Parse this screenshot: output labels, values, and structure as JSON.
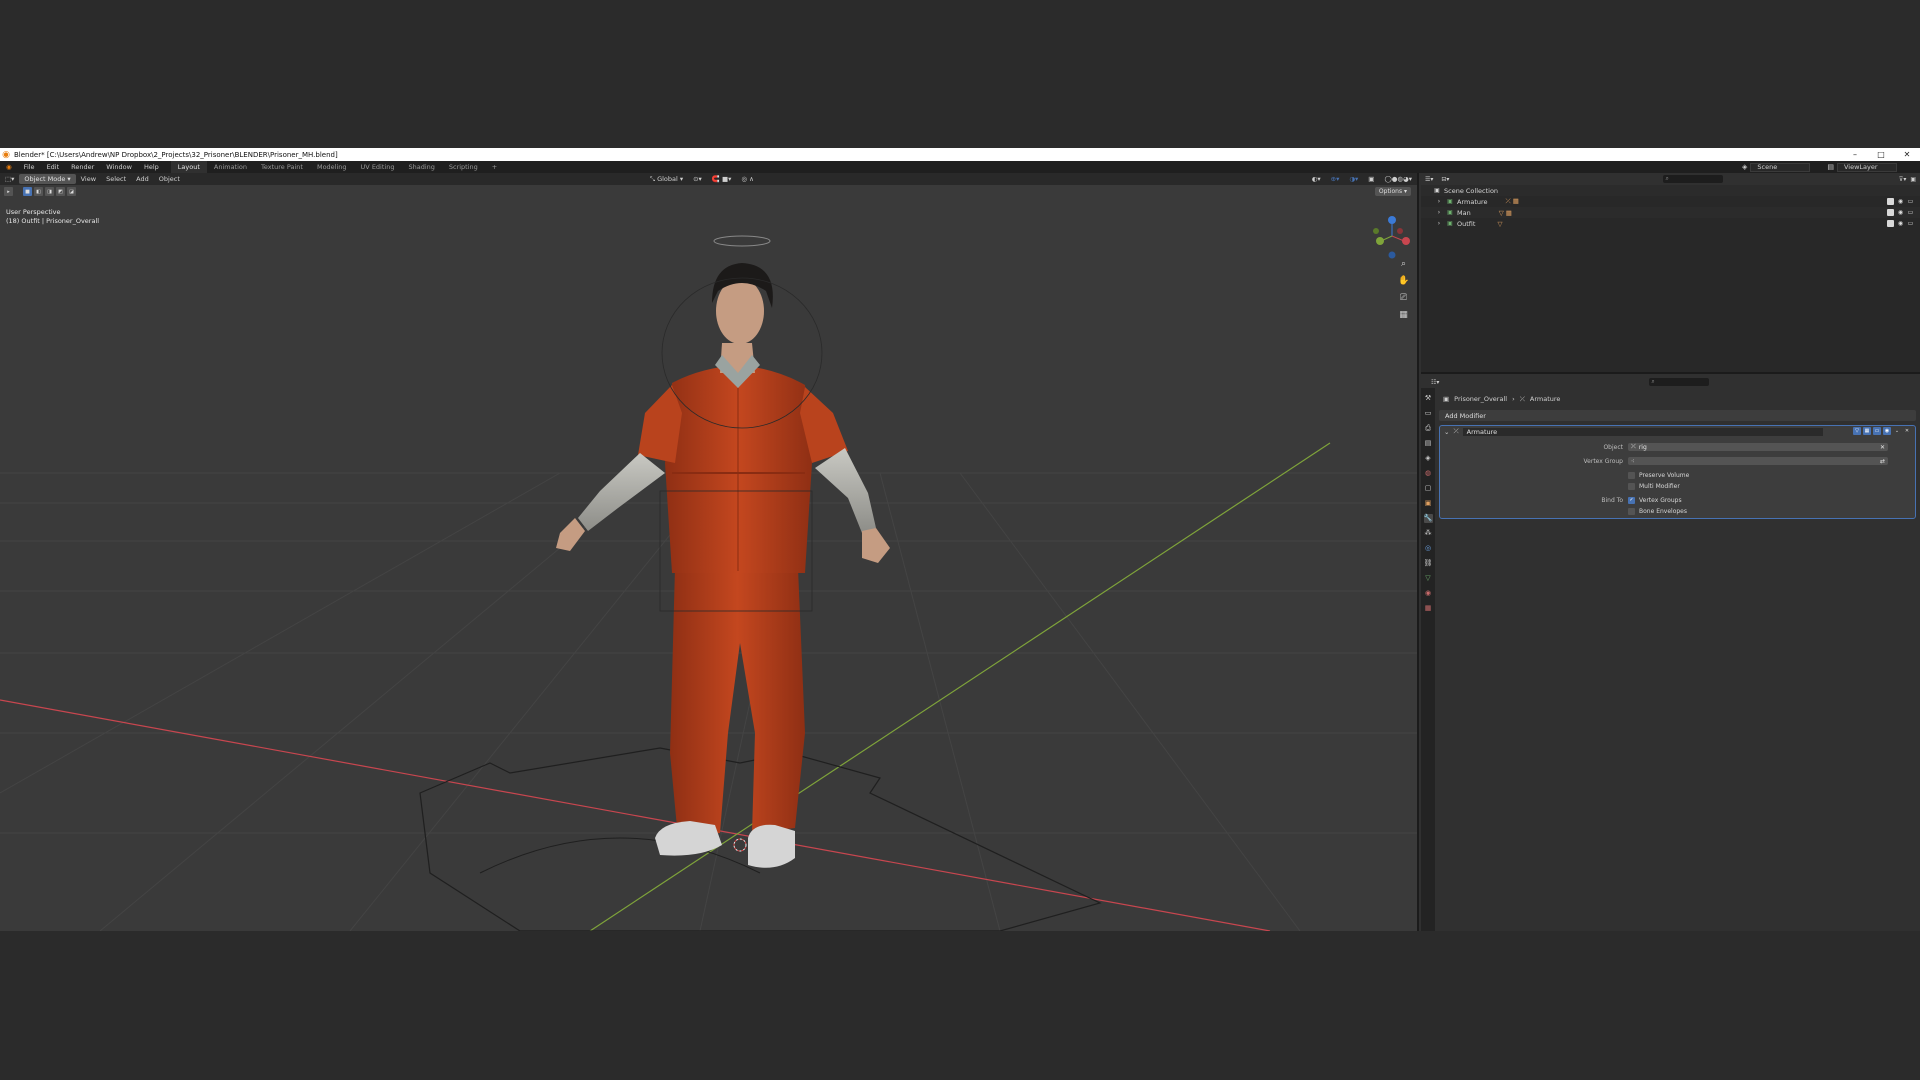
{
  "titlebar": {
    "title": "Blender* [C:\\Users\\Andrew\\NP Dropbox\\2_Projects\\32_Prisoner\\BLENDER\\Prisoner_MH.blend]",
    "min": "–",
    "max": "□",
    "close": "✕"
  },
  "menubar": {
    "menus": [
      "File",
      "Edit",
      "Render",
      "Window",
      "Help"
    ],
    "workspaces": [
      "Layout",
      "Animation",
      "Texture Paint",
      "Modeling",
      "UV Editing",
      "Shading",
      "Scripting",
      "+"
    ],
    "active_workspace": "Layout",
    "scene": "Scene",
    "view_layer": "ViewLayer"
  },
  "viewport": {
    "mode": "Object Mode",
    "menus": [
      "View",
      "Select",
      "Add",
      "Object"
    ],
    "orientation": "Global",
    "options": "Options",
    "perspective": "User Perspective",
    "object_info": "(18) Outfit | Prisoner_Overall"
  },
  "outliner": {
    "root": "Scene Collection",
    "items": [
      {
        "name": "Armature"
      },
      {
        "name": "Man"
      },
      {
        "name": "Outfit"
      }
    ]
  },
  "properties": {
    "breadcrumb_object": "Prisoner_Overall",
    "breadcrumb_modifier": "Armature",
    "add_modifier": "Add Modifier",
    "modifier": {
      "name": "Armature",
      "object_label": "Object",
      "object_value": "rig",
      "vertex_group_label": "Vertex Group",
      "vertex_group_value": "",
      "preserve_volume": "Preserve Volume",
      "multi_modifier": "Multi Modifier",
      "bind_to_label": "Bind To",
      "vertex_groups": "Vertex Groups",
      "bone_envelopes": "Bone Envelopes"
    }
  },
  "colors": {
    "accent": "#4772b3",
    "jumpsuit": "#b7401c",
    "x_axis": "#c8464f",
    "y_axis": "#7fa43a"
  }
}
